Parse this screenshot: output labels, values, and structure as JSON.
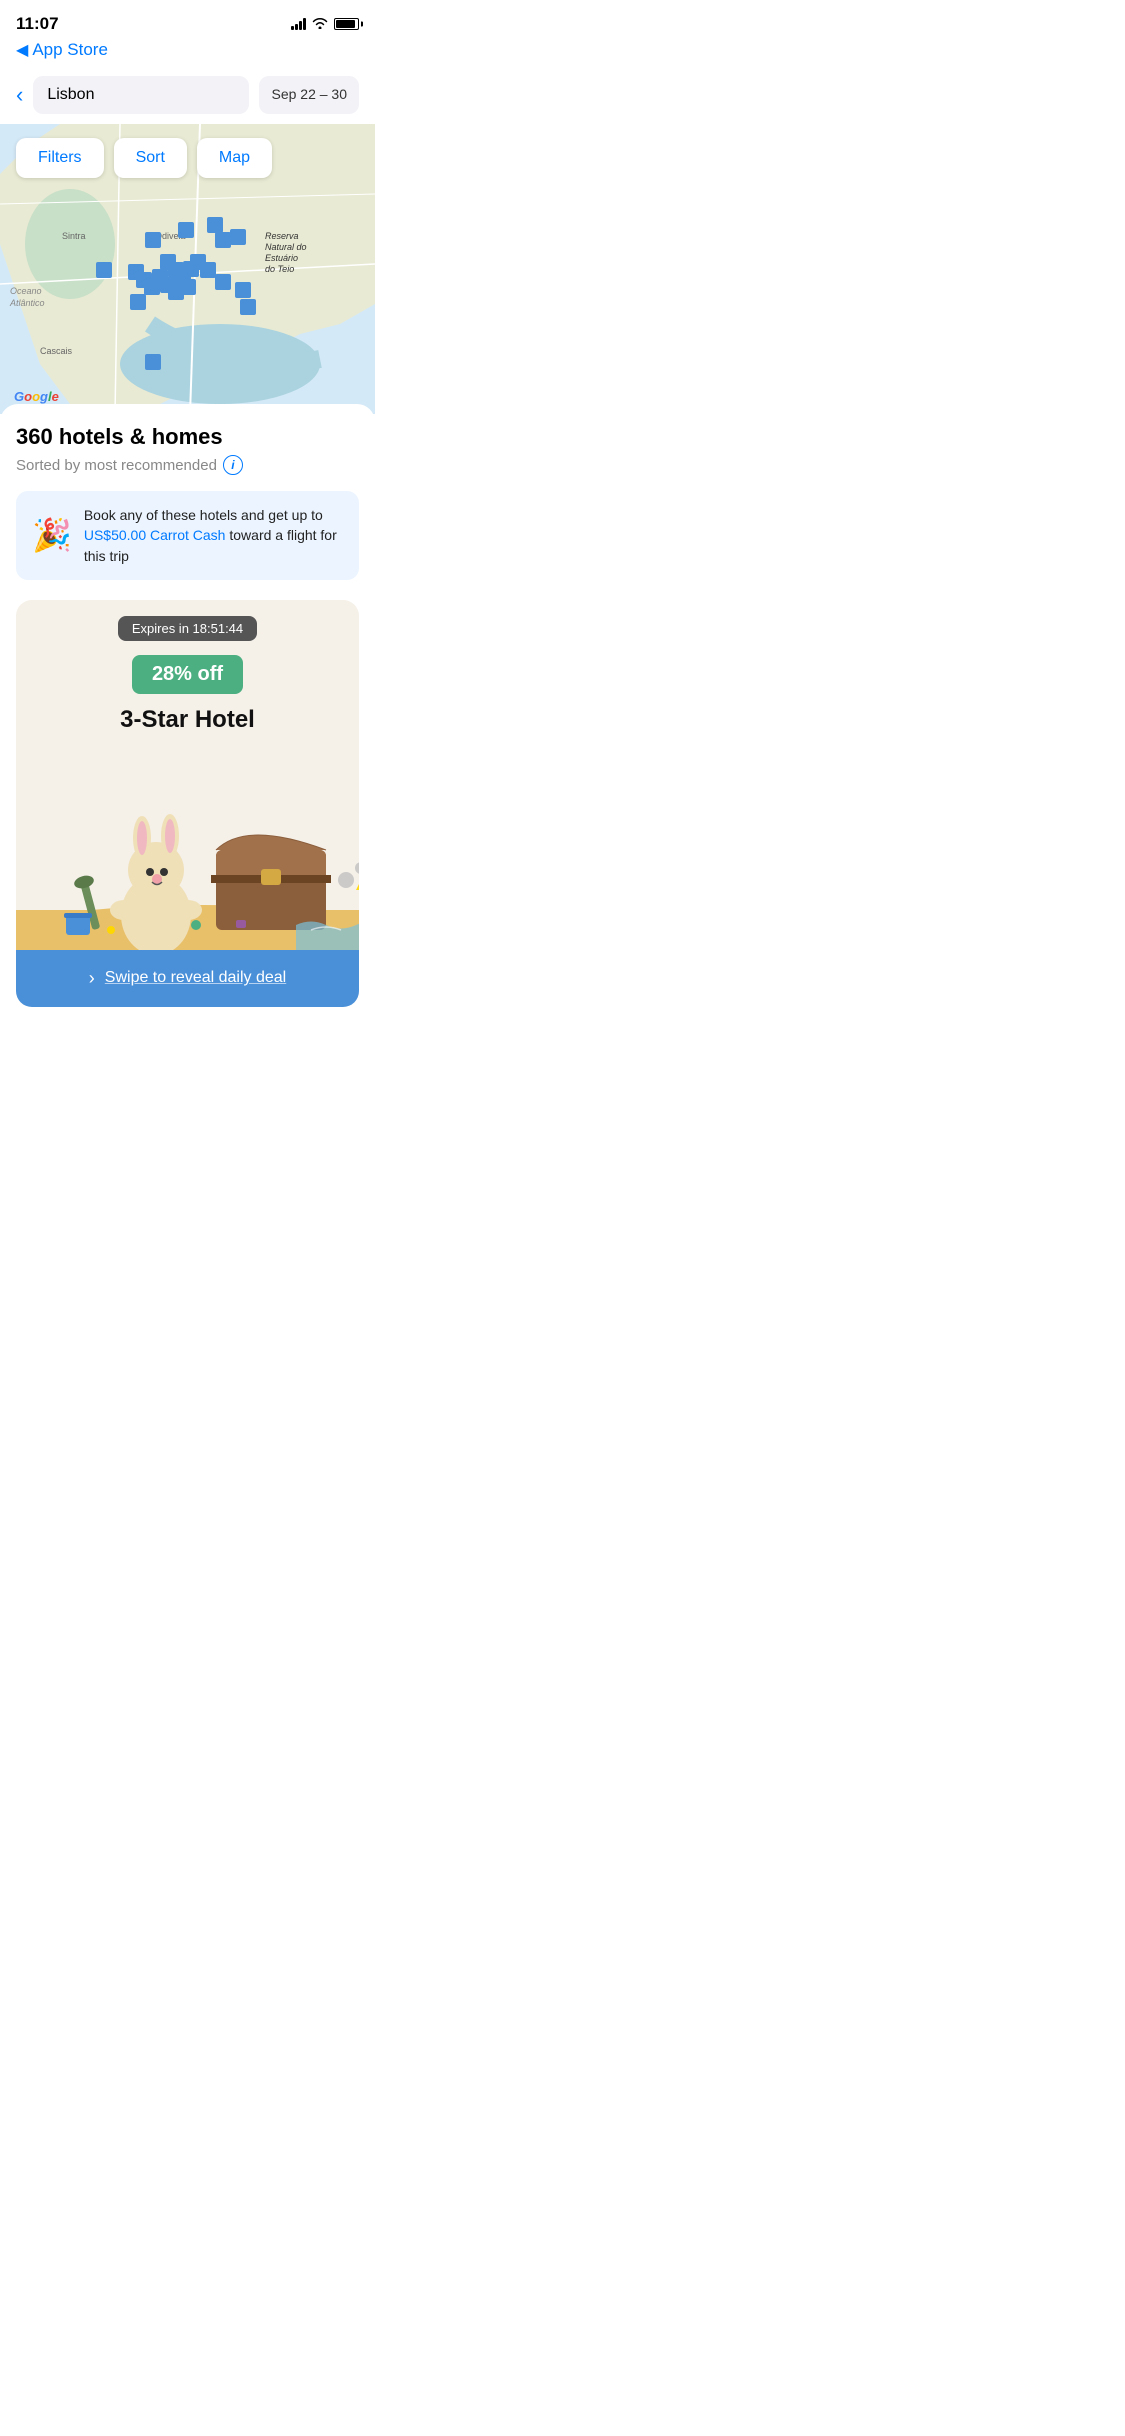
{
  "status_bar": {
    "time": "11:07",
    "signal_bars": 4,
    "wifi": true,
    "battery_full": true
  },
  "nav": {
    "back_label": "App Store",
    "back_arrow": "◀"
  },
  "search_header": {
    "back_arrow": "‹",
    "location": "Lisbon",
    "date_range": "Sep 22 – 30"
  },
  "map_filters": {
    "filters_label": "Filters",
    "sort_label": "Sort",
    "map_label": "Map"
  },
  "map": {
    "labels": {
      "oceano_atlantico": "Oceano\nAtlântico",
      "sintra": "Sintra",
      "cascais": "Cascais",
      "odivelas": "Odivela",
      "reserva": "Reserva\nNatural do\nEstuário\ndo Teio"
    },
    "google_text": "Google"
  },
  "results": {
    "count_text": "360 hotels & homes",
    "sort_text": "Sorted by most recommended",
    "info_icon": "i"
  },
  "carrot_banner": {
    "emoji": "🎉",
    "text_before": "Book any of these hotels and get up to ",
    "amount": "US$50.00 Carrot Cash",
    "text_after": " toward a flight for this trip"
  },
  "deal_card": {
    "expires_text": "Expires in 18:51:44",
    "discount_text": "28% off",
    "hotel_label": "3-Star Hotel",
    "deal_bg_color": "#F5F0E8",
    "discount_color": "#4CAF82"
  },
  "swipe_cta": {
    "arrow": "›",
    "text": "Swipe to reveal daily deal"
  }
}
